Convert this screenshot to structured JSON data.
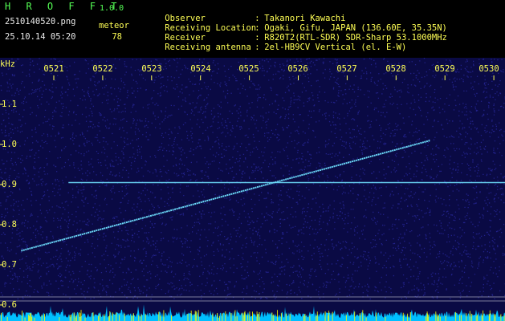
{
  "header": {
    "title": "H R O F F T",
    "version": "1.0.0",
    "file_name": "2510140520.png",
    "datetime": "25.10.14 05:20",
    "meteor_label": "meteor",
    "meteor_count": "78"
  },
  "station": [
    {
      "key": "Observer",
      "sep": ":",
      "value": "Takanori Kawachi"
    },
    {
      "key": "Receiving Location",
      "sep": ":",
      "value": "Ogaki, Gifu, JAPAN (136.60E, 35.35N)"
    },
    {
      "key": "Receiver",
      "sep": ":",
      "value": "R820T2(RTL-SDR) SDR-Sharp 53.1000MHz"
    },
    {
      "key": "Receiving antenna",
      "sep": ":",
      "value": "2el-HB9CV Vertical (el. E-W)"
    }
  ],
  "chart_data": {
    "type": "heatmap",
    "ylabel": "kHz",
    "x_ticks": [
      "0521",
      "0522",
      "0523",
      "0524",
      "0525",
      "0526",
      "0527",
      "0528",
      "0529",
      "0530"
    ],
    "y_ticks": [
      "1.1",
      "1.0",
      "0.9",
      "0.8",
      "0.7",
      "0.6"
    ],
    "ylim": [
      0.6,
      1.17
    ],
    "xlim_minutes": [
      5.333,
      30.333
    ],
    "carrier_khz": 0.905,
    "carrier_start_minute": 21.3,
    "reference_lines_khz": [
      0.62,
      0.61
    ],
    "sweep": {
      "start_minute": 20.333,
      "start_khz": 0.735,
      "end_minute": 28.7,
      "end_khz": 1.01
    },
    "colors": {
      "background": "#0a0a44",
      "noise": "#2a2aa0",
      "signal": "#6fe0ff",
      "baseline": "#00bfff",
      "axis_text": "#ffff55"
    }
  }
}
